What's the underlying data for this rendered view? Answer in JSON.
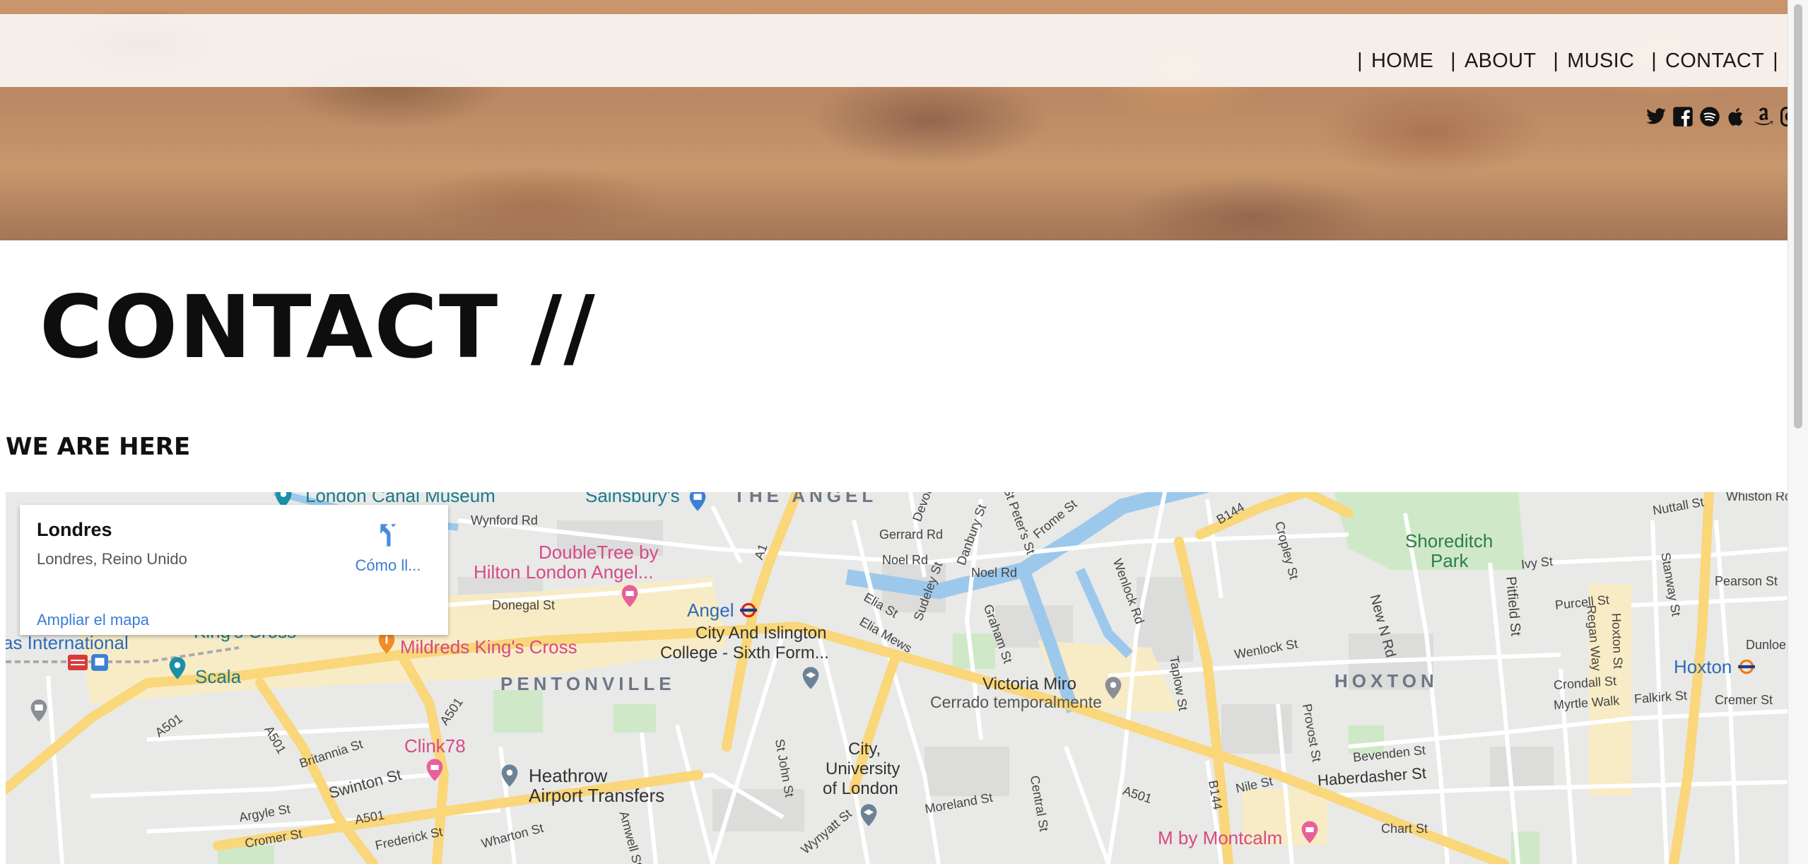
{
  "nav": {
    "items": [
      "HOME",
      "ABOUT",
      "MUSIC",
      "CONTACT"
    ],
    "separator": "|"
  },
  "social": [
    "twitter-icon",
    "facebook-icon",
    "spotify-icon",
    "apple-icon",
    "amazon-icon",
    "instagram-icon"
  ],
  "page": {
    "title": "CONTACT //",
    "subtitle": "WE ARE HERE"
  },
  "map": {
    "card": {
      "place_name": "Londres",
      "place_address": "Londres, Reino Unido",
      "directions_label": "Cómo ll...",
      "enlarge_link": "Ampliar el mapa"
    },
    "labels": {
      "canal_museum": "London Canal Museum",
      "sainsburys": "Sainsbury's",
      "the_angel": "THE ANGEL",
      "doubletree_1": "DoubleTree by",
      "doubletree_2": "Hilton London Angel...",
      "angel": "Angel",
      "mildreds": "Mildreds King's Cross",
      "kings_cross": "King's Cross",
      "international": "as International",
      "scala": "Scala",
      "pentonville": "PENTONVILLE",
      "college_1": "City And Islington",
      "college_2": "College - Sixth Form...",
      "victoria_miro": "Victoria Miro",
      "cerrado": "Cerrado temporalmente",
      "hoxton_district": "HOXTON",
      "hoxton_station": "Hoxton",
      "shoreditch_1": "Shoreditch",
      "shoreditch_2": "Park",
      "clink": "Clink78",
      "heathrow_1": "Heathrow",
      "heathrow_2": "Airport Transfers",
      "city_uni_1": "City,",
      "city_uni_2": "University",
      "city_uni_3": "of London",
      "montcalm": "M by Montcalm",
      "wynford": "Wynford Rd",
      "donegal": "Donegal St",
      "gerrard": "Gerrard Rd",
      "noel": "Noel Rd",
      "noel2": "Noel Rd",
      "a1": "A1",
      "a501": "A501",
      "a501b": "A501",
      "a501c": "A501",
      "a501d": "A501",
      "a501e": "A501",
      "b144": "B144",
      "b144b": "B144",
      "swinton": "Swinton St",
      "britannia": "Britannia St",
      "argyle": "Argyle St",
      "cromer": "Cromer St",
      "frederick": "Frederick St",
      "wharton": "Wharton St",
      "amwell": "Amwell St",
      "st_john": "St John St",
      "wynyatt": "Wynyatt St",
      "moreland": "Moreland St",
      "central": "Central St",
      "nile": "Nile St",
      "haberdasher": "Haberdasher St",
      "bevenden": "Bevenden St",
      "chart": "Chart St",
      "provost": "Provost St",
      "taplow": "Taplow St",
      "wenlock": "Wenlock St",
      "wenlock_rd": "Wenlock Rd",
      "new_n_rd": "New N Rd",
      "pitfield": "Pitfield St",
      "purcell": "Purcell St",
      "crondall": "Crondall St",
      "myrtle": "Myrtle Walk",
      "falkirk": "Falkirk St",
      "cremer": "Cremer St",
      "pearson": "Pearson St",
      "whiston": "Whiston Ro",
      "nuttall": "Nuttall St",
      "ivy": "Ivy St",
      "dunloe": "Dunloe",
      "regan": "Regan Way",
      "hoxton_st": "Hoxton St",
      "stanway": "Stanway St",
      "cropley": "Cropley St",
      "elia": "Elia St",
      "elia_mews": "Elia Mews",
      "sudeley": "Sudeley St",
      "graham": "Graham St",
      "danbury": "Danbury St",
      "st_peters": "St Peter's St",
      "frome": "Frome St",
      "devonia": "Devon"
    }
  }
}
